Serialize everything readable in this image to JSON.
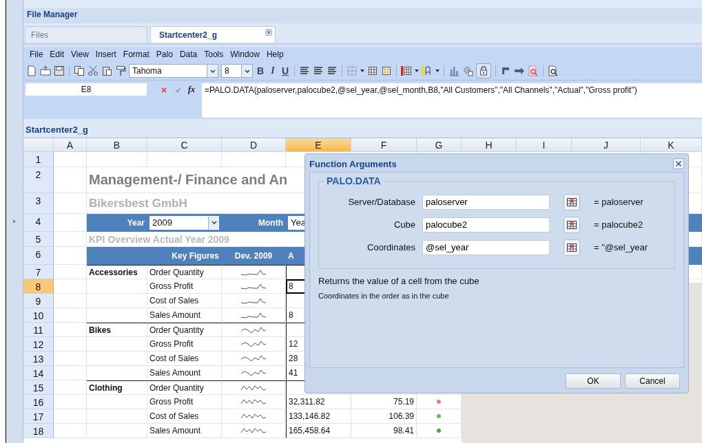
{
  "app_title": "File Manager",
  "tabs": [
    {
      "label": "Files",
      "selected": false,
      "closable": false
    },
    {
      "label": "Startcenter2_g",
      "selected": true,
      "closable": true
    }
  ],
  "menu": [
    "File",
    "Edit",
    "View",
    "Insert",
    "Format",
    "Palo",
    "Data",
    "Tools",
    "Window",
    "Help"
  ],
  "toolbar": {
    "font": "Tahoma",
    "font_size": "8",
    "style_glyphs": [
      "B",
      "I",
      "U"
    ],
    "lock_pressed": true
  },
  "formula_bar": {
    "cell_ref": "E8",
    "function_symbol": "fx",
    "formula": "=PALO.DATA(paloserver,palocube2,@sel_year,@sel_month,B8,\"All Customers\",\"All Channels\",\"Actual\",\"Gross profit\")"
  },
  "sheet": {
    "title": "Startcenter2_g",
    "columns": [
      {
        "label": "A",
        "selected": false
      },
      {
        "label": "B",
        "selected": false
      },
      {
        "label": "C",
        "selected": false
      },
      {
        "label": "D",
        "selected": false
      },
      {
        "label": "E",
        "selected": true
      },
      {
        "label": "F",
        "selected": false
      },
      {
        "label": "G",
        "selected": false
      },
      {
        "label": "H",
        "selected": false
      },
      {
        "label": "I",
        "selected": false
      },
      {
        "label": "J",
        "selected": false
      },
      {
        "label": "K",
        "selected": false
      }
    ],
    "rows": [
      {
        "number": "1",
        "selected": false,
        "kind": "blank"
      },
      {
        "number": "2",
        "selected": false,
        "kind": "title",
        "text": "Management-/ Finance and An"
      },
      {
        "number": "3",
        "selected": false,
        "kind": "subtitle",
        "text": "Bikersbest GmbH"
      },
      {
        "number": "4",
        "selected": false,
        "kind": "selector",
        "year_label": "Year",
        "year_value": "2009",
        "month_label": "Month",
        "month_value": "Yea"
      },
      {
        "number": "5",
        "selected": false,
        "kind": "caption",
        "text": "KPI Overview Actual Year 2009"
      },
      {
        "number": "6",
        "selected": false,
        "kind": "header",
        "figures": "Key Figures",
        "deviation": "Dev. 2009",
        "actual": "A"
      },
      {
        "number": "7",
        "selected": false,
        "kind": "data",
        "group": "Accessories",
        "figure": "Order Quantity",
        "actual": "",
        "cell_selected": false
      },
      {
        "number": "8",
        "selected": true,
        "kind": "data",
        "group": "",
        "figure": "Gross Profit",
        "actual": "8",
        "cell_selected": true
      },
      {
        "number": "9",
        "selected": false,
        "kind": "data",
        "group": "",
        "figure": "Cost of Sales",
        "actual": "",
        "cell_selected": false
      },
      {
        "number": "10",
        "selected": false,
        "kind": "data",
        "group": "",
        "figure": "Sales Amount",
        "actual": "8",
        "cell_selected": false
      },
      {
        "number": "11",
        "selected": false,
        "kind": "data",
        "group": "Bikes",
        "figure": "Order Quantity",
        "actual": "",
        "cell_selected": false
      },
      {
        "number": "12",
        "selected": false,
        "kind": "data",
        "group": "",
        "figure": "Gross Profit",
        "actual": "12",
        "cell_selected": false
      },
      {
        "number": "13",
        "selected": false,
        "kind": "data",
        "group": "",
        "figure": "Cost of Sales",
        "actual": "28",
        "cell_selected": false
      },
      {
        "number": "14",
        "selected": false,
        "kind": "data",
        "group": "",
        "figure": "Sales Amount",
        "actual": "41",
        "cell_selected": false
      },
      {
        "number": "15",
        "selected": false,
        "kind": "data",
        "group": "Clothing",
        "figure": "Order Quantity",
        "actual": "",
        "cell_selected": false
      },
      {
        "number": "16",
        "selected": false,
        "kind": "data",
        "group": "",
        "figure": "Gross Profit",
        "actual": "32,311.82",
        "dev": "75.19",
        "color": "#e08080",
        "cell_selected": false
      },
      {
        "number": "17",
        "selected": false,
        "kind": "data",
        "group": "",
        "figure": "Cost of Sales",
        "actual": "133,146.82",
        "dev": "106.39",
        "color": "#66bb66",
        "cell_selected": false
      },
      {
        "number": "18",
        "selected": false,
        "kind": "data",
        "group": "",
        "figure": "Sales Amount",
        "actual": "165,458.64",
        "dev": "98.41",
        "color": "#44aa44",
        "cell_selected": false
      }
    ]
  },
  "dialog": {
    "title": "Function Arguments",
    "function_name": "PALO.DATA",
    "arguments": [
      {
        "label": "Server/Database",
        "value": "paloserver",
        "result": "= paloserver"
      },
      {
        "label": "Cube",
        "value": "palocube2",
        "result": "= palocube2"
      },
      {
        "label": "Coordinates",
        "value": "@sel_year",
        "result": "= \"@sel_year"
      }
    ],
    "description": "Returns the value of a cell from the cube",
    "hint": "Coordinates in the order as in the cube",
    "buttons": [
      "OK",
      "Cancel"
    ]
  }
}
